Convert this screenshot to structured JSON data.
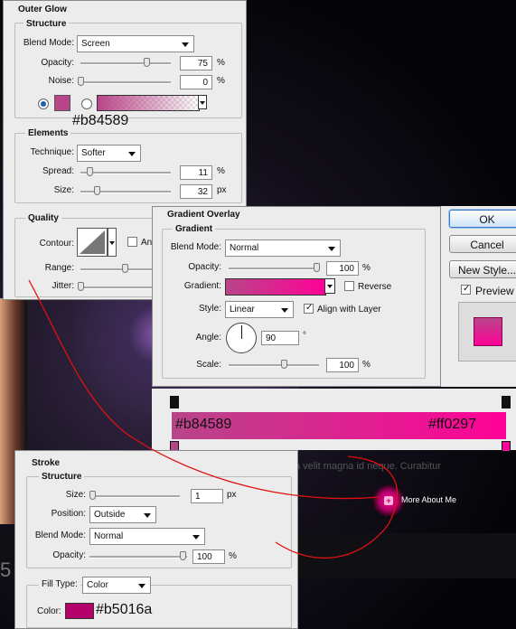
{
  "colors": {
    "glow": "#b84589",
    "gradient_start": "#b84589",
    "gradient_end": "#ff0297",
    "stroke": "#b5016a"
  },
  "outer_glow": {
    "title": "Outer Glow",
    "structure_label": "Structure",
    "blend_mode_label": "Blend Mode:",
    "blend_mode": "Screen",
    "opacity_label": "Opacity:",
    "opacity": "75",
    "noise_label": "Noise:",
    "noise": "0",
    "pct": "%",
    "px": "px",
    "color_hex": "#b84589",
    "elements_label": "Elements",
    "technique_label": "Technique:",
    "technique": "Softer",
    "spread_label": "Spread:",
    "spread": "11",
    "size_label": "Size:",
    "size": "32",
    "quality_label": "Quality",
    "contour_label": "Contour:",
    "antialiased_label": "An",
    "range_label": "Range:",
    "jitter_label": "Jitter:"
  },
  "gradient_overlay": {
    "title": "Gradient Overlay",
    "gradient_group": "Gradient",
    "blend_mode_label": "Blend Mode:",
    "blend_mode": "Normal",
    "opacity_label": "Opacity:",
    "opacity": "100",
    "pct": "%",
    "gradient_label": "Gradient:",
    "reverse_label": "Reverse",
    "style_label": "Style:",
    "style": "Linear",
    "align_label": "Align with Layer",
    "angle_label": "Angle:",
    "angle": "90",
    "degree": "°",
    "scale_label": "Scale:",
    "scale": "100"
  },
  "buttons": {
    "ok": "OK",
    "cancel": "Cancel",
    "new_style": "New Style...",
    "preview": "Preview"
  },
  "gradient_editor": {
    "start_hex": "#b84589",
    "end_hex": "#ff0297"
  },
  "stroke": {
    "title": "Stroke",
    "structure_label": "Structure",
    "size_label": "Size:",
    "size": "1",
    "px": "px",
    "position_label": "Position:",
    "position": "Outside",
    "blend_mode_label": "Blend Mode:",
    "blend_mode": "Normal",
    "opacity_label": "Opacity:",
    "opacity": "100",
    "pct": "%",
    "fill_type_label": "Fill Type:",
    "fill_type": "Color",
    "color_label": "Color:",
    "color_hex": "#b5016a"
  },
  "background": {
    "lorem": "a velit magna id neque. Curabitur",
    "more_button": "More About Me",
    "edge_digit": "5"
  }
}
